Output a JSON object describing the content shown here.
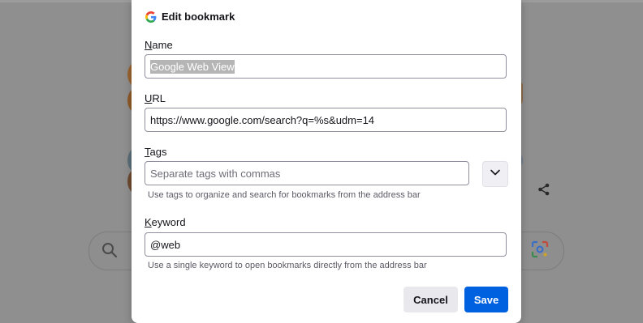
{
  "dialog": {
    "title": "Edit bookmark",
    "name": {
      "label_accel": "N",
      "label_rest": "ame",
      "value": "Google Web View"
    },
    "url": {
      "label_accel": "U",
      "label_rest": "RL",
      "value": "https://www.google.com/search?q=%s&udm=14"
    },
    "tags": {
      "label_accel": "T",
      "label_rest": "ags",
      "placeholder": "Separate tags with commas",
      "hint": "Use tags to organize and search for bookmarks from the address bar"
    },
    "keyword": {
      "label_accel": "K",
      "label_rest": "eyword",
      "value": "@web",
      "hint": "Use a single keyword to open bookmarks directly from the address bar"
    },
    "buttons": {
      "cancel": "Cancel",
      "save": "Save"
    }
  },
  "colors": {
    "accent": "#0061e0",
    "overlay": "#8f8f8f"
  }
}
